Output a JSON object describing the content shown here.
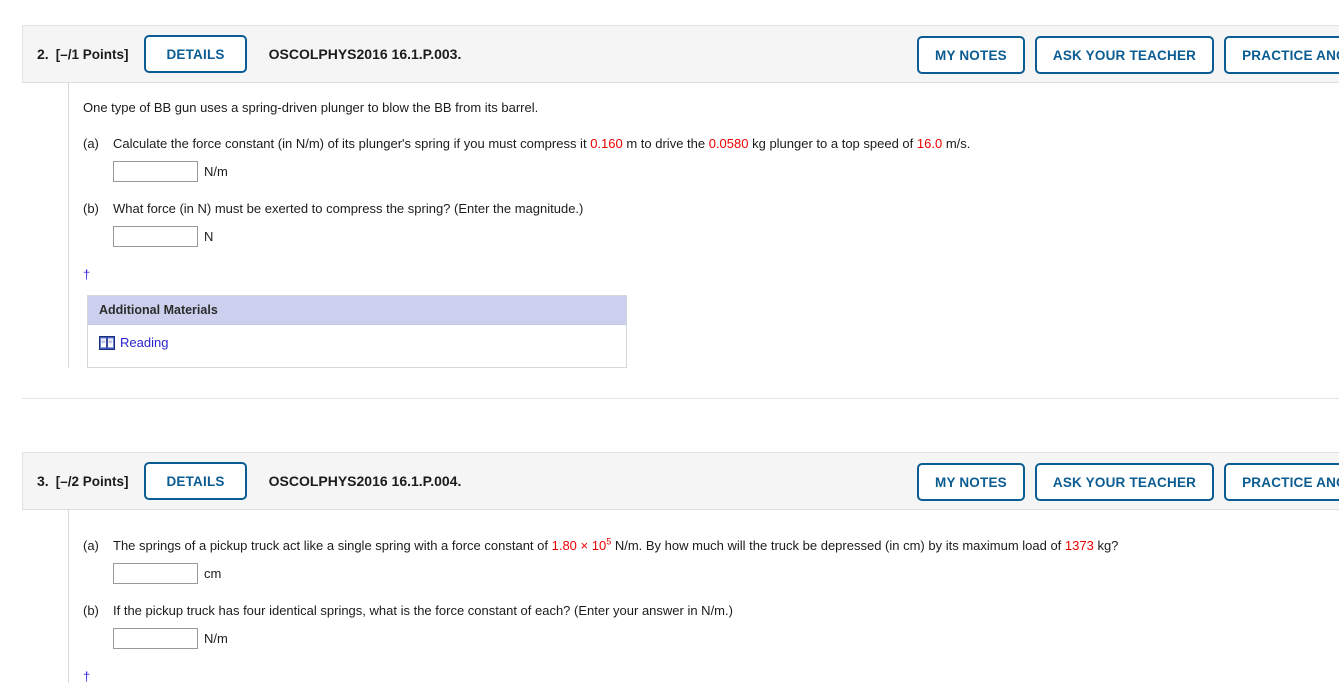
{
  "questions": [
    {
      "number": "2.",
      "points": "[–/1 Points]",
      "details_label": "DETAILS",
      "code": "OSCOLPHYS2016 16.1.P.003.",
      "buttons": {
        "my_notes": "MY NOTES",
        "ask_your_teacher": "ASK YOUR TEACHER",
        "practice_another": "PRACTICE ANOTHER"
      },
      "intro": "One type of BB gun uses a spring-driven plunger to blow the BB from its barrel.",
      "parts": [
        {
          "label": "(a)",
          "text_1": "Calculate the force constant (in N/m) of its plunger's spring if you must compress it ",
          "value_1": "0.160",
          "text_2": " m to drive the ",
          "value_2": "0.0580",
          "text_3": " kg plunger to a top speed of ",
          "value_3": "16.0",
          "text_4": " m/s.",
          "input_value": "",
          "unit": "N/m"
        },
        {
          "label": "(b)",
          "text_1": "What force (in N) must be exerted to compress the spring? (Enter the magnitude.)",
          "input_value": "",
          "unit": "N"
        }
      ],
      "footnote": "†",
      "materials": {
        "title": "Additional Materials",
        "link_label": "Reading",
        "icon": "book-icon"
      }
    },
    {
      "number": "3.",
      "points": "[–/2 Points]",
      "details_label": "DETAILS",
      "code": "OSCOLPHYS2016 16.1.P.004.",
      "buttons": {
        "my_notes": "MY NOTES",
        "ask_your_teacher": "ASK YOUR TEACHER",
        "practice_another": "PRACTICE ANOTHER"
      },
      "parts": [
        {
          "label": "(a)",
          "text_1": "The springs of a pickup truck act like a single spring with a force constant of ",
          "value_1": "1.80 × 10",
          "value_1_sup": "5",
          "text_2": " N/m. By how much will the truck be depressed (in cm) by its maximum load of ",
          "value_2": "1373",
          "text_3": " kg?",
          "input_value": "",
          "unit": "cm"
        },
        {
          "label": "(b)",
          "text_1": "If the pickup truck has four identical springs, what is the force constant of each? (Enter your answer in N/m.)",
          "input_value": "",
          "unit": "N/m"
        }
      ],
      "footnote": "†"
    }
  ],
  "colors": {
    "accent": "#0b5c92",
    "value_red": "#ee0000",
    "link_blue": "#2a24cf",
    "header_bg": "#f5f5f5",
    "materials_header_bg": "#ccd0ee"
  }
}
